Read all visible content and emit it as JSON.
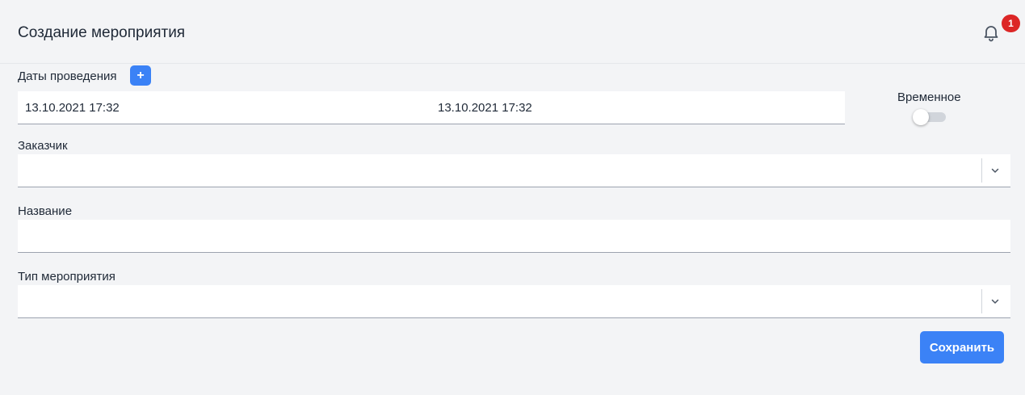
{
  "header": {
    "title": "Создание мероприятия",
    "notifications": {
      "icon": "bell-icon",
      "count": "1"
    }
  },
  "form": {
    "dates": {
      "label": "Даты проведения",
      "add_label": "+",
      "start": "13.10.2021 17:32",
      "end": "13.10.2021 17:32"
    },
    "temporary": {
      "label": "Временное",
      "enabled": false
    },
    "customer": {
      "label": "Заказчик",
      "value": ""
    },
    "name": {
      "label": "Название",
      "value": ""
    },
    "event_type": {
      "label": "Тип мероприятия",
      "value": ""
    },
    "save_label": "Сохранить"
  },
  "colors": {
    "accent": "#3b82f6",
    "badge": "#dc2626",
    "background": "#f3f4f6"
  }
}
